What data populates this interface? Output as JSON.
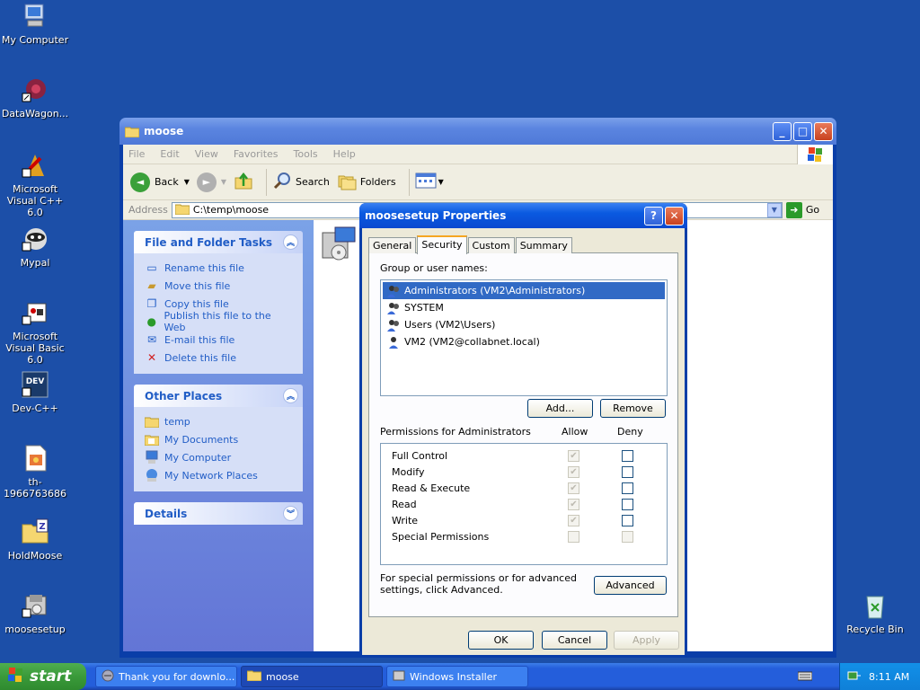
{
  "desktop": {
    "icons": [
      {
        "label": "My Computer"
      },
      {
        "label": "DataWagon..."
      },
      {
        "label": "Microsoft Visual C++ 6.0"
      },
      {
        "label": "Mypal"
      },
      {
        "label": "Microsoft Visual Basic 6.0"
      },
      {
        "label": "Dev-C++"
      },
      {
        "label": "th-1966763686"
      },
      {
        "label": "HoldMoose"
      },
      {
        "label": "moosesetup"
      },
      {
        "label": "Recycle Bin"
      }
    ]
  },
  "explorer": {
    "title": "moose",
    "menu": [
      "File",
      "Edit",
      "View",
      "Favorites",
      "Tools",
      "Help"
    ],
    "toolbar": {
      "back": "Back",
      "search": "Search",
      "folders": "Folders"
    },
    "address_label": "Address",
    "address_value": "C:\\temp\\moose",
    "go_label": "Go",
    "file_tasks": {
      "title": "File and Folder Tasks",
      "items": [
        "Rename this file",
        "Move this file",
        "Copy this file",
        "Publish this file to the Web",
        "E-mail this file",
        "Delete this file"
      ]
    },
    "other_places": {
      "title": "Other Places",
      "items": [
        "temp",
        "My Documents",
        "My Computer",
        "My Network Places"
      ]
    },
    "details": {
      "title": "Details"
    }
  },
  "dialog": {
    "title": "moosesetup Properties",
    "tabs": [
      "General",
      "Security",
      "Custom",
      "Summary"
    ],
    "active_tab": "Security",
    "group_label": "Group or user names:",
    "users": [
      "Administrators (VM2\\Administrators)",
      "SYSTEM",
      "Users (VM2\\Users)",
      "VM2 (VM2@collabnet.local)"
    ],
    "add_label": "Add...",
    "remove_label": "Remove",
    "perm_label": "Permissions for Administrators",
    "allow_label": "Allow",
    "deny_label": "Deny",
    "permissions": [
      {
        "name": "Full Control",
        "allow": true,
        "deny": false
      },
      {
        "name": "Modify",
        "allow": true,
        "deny": false
      },
      {
        "name": "Read & Execute",
        "allow": true,
        "deny": false
      },
      {
        "name": "Read",
        "allow": true,
        "deny": false
      },
      {
        "name": "Write",
        "allow": true,
        "deny": false
      },
      {
        "name": "Special Permissions",
        "allow": false,
        "deny": false
      }
    ],
    "advanced_text": "For special permissions or for advanced settings, click Advanced.",
    "advanced_label": "Advanced",
    "ok_label": "OK",
    "cancel_label": "Cancel",
    "apply_label": "Apply"
  },
  "taskbar": {
    "start_label": "start",
    "tasks": [
      "Thank you for downlo...",
      "moose",
      "Windows Installer"
    ],
    "clock": "8:11 AM"
  }
}
